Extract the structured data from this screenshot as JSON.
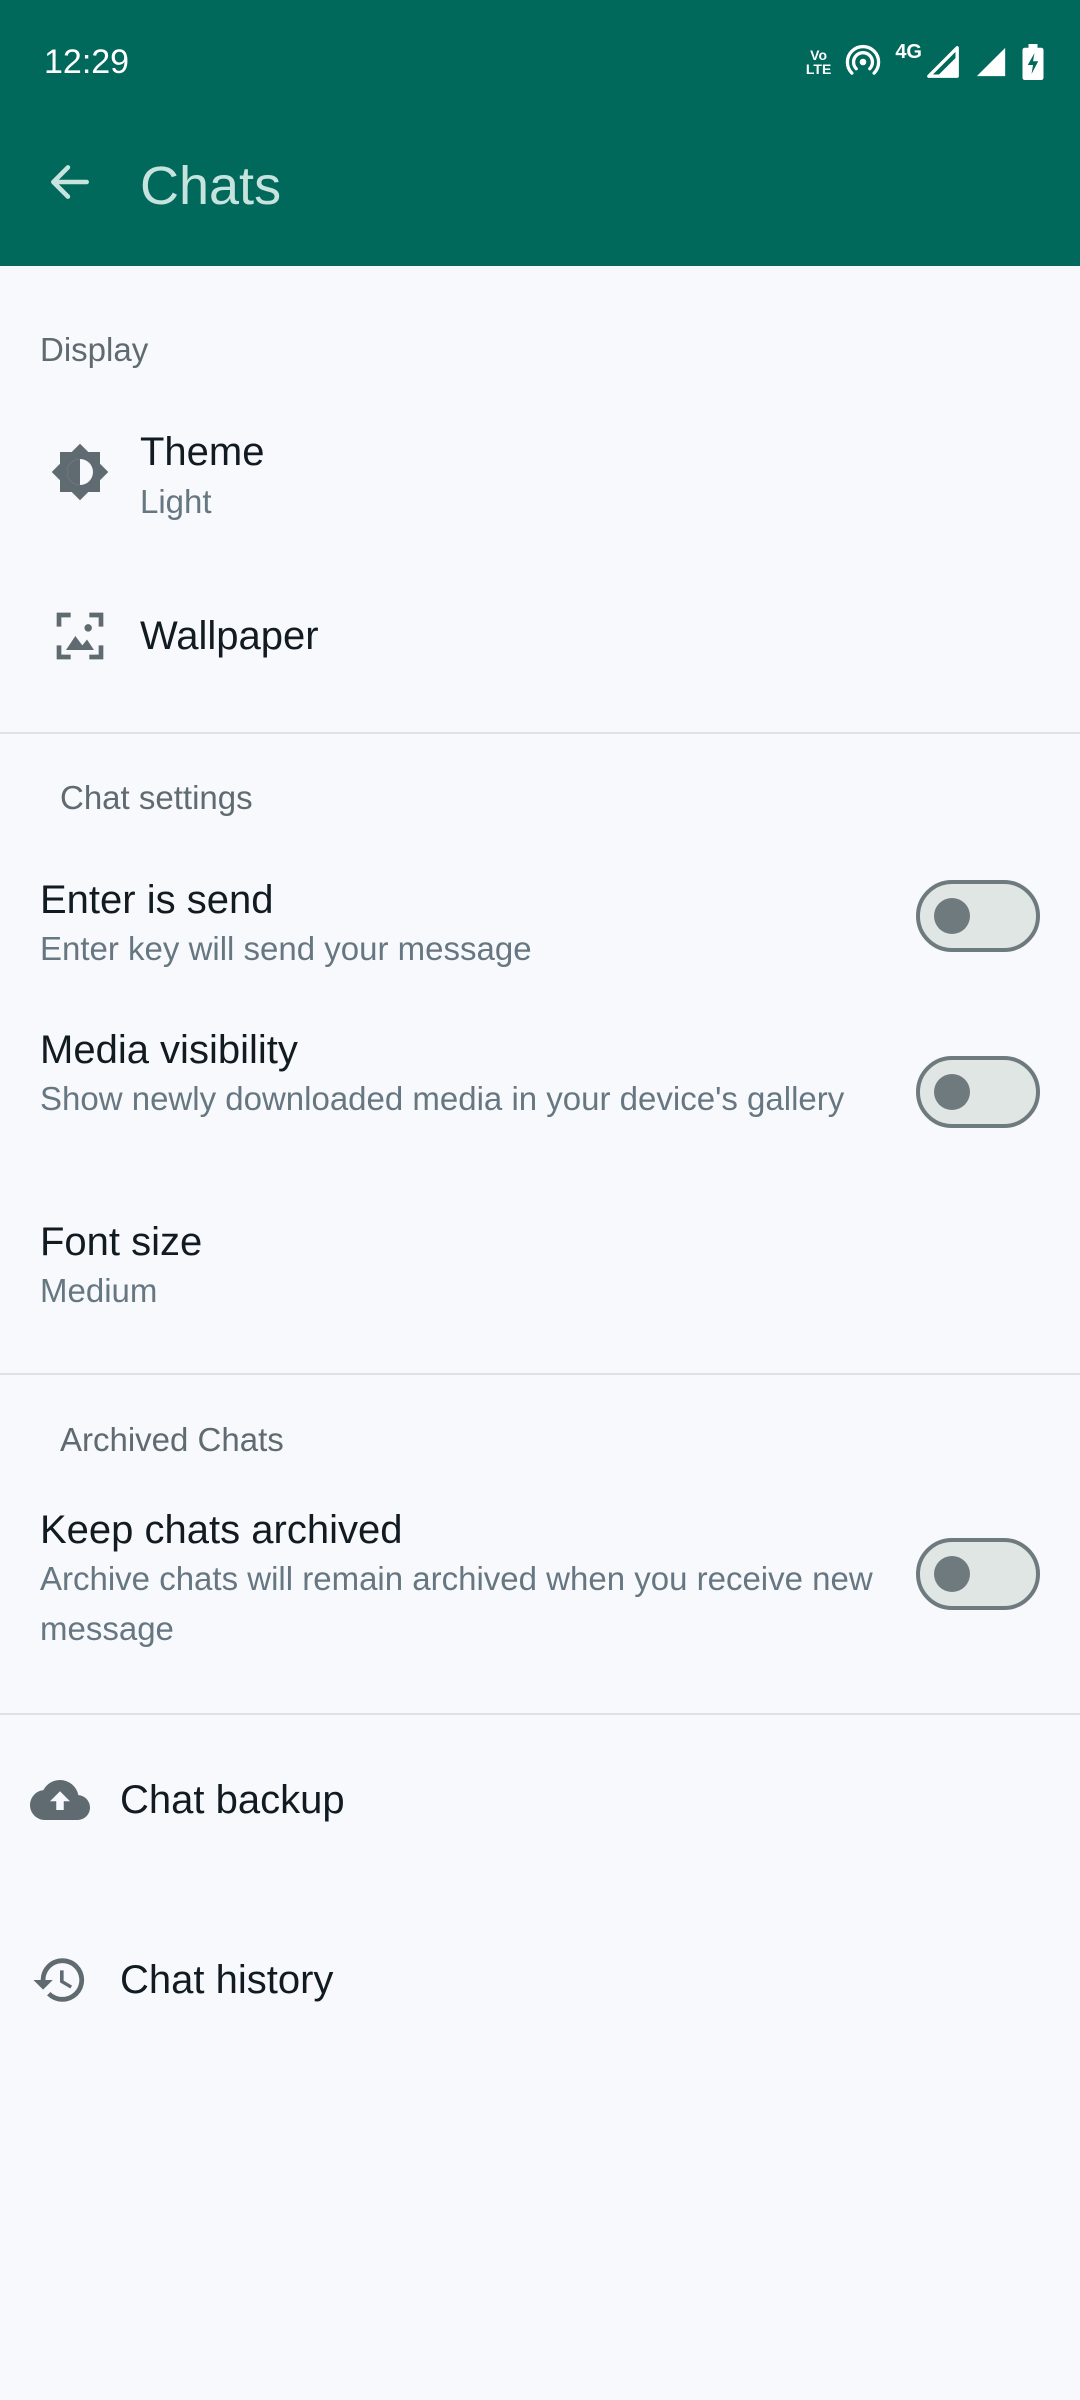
{
  "status_bar": {
    "time": "12:29",
    "volte_top": "Vo",
    "volte_bottom": "LTE",
    "network_label": "4G",
    "icons": [
      "volte-icon",
      "hotspot-icon",
      "signal-icon",
      "signal-icon",
      "battery-charging-icon"
    ]
  },
  "app_bar": {
    "back_icon": "arrow-back-icon",
    "title": "Chats",
    "background": "#00695c"
  },
  "display": {
    "header": "Display",
    "theme": {
      "title": "Theme",
      "subtitle": "Light",
      "icon": "theme-icon"
    },
    "wallpaper": {
      "title": "Wallpaper",
      "icon": "wallpaper-icon"
    }
  },
  "chat_settings": {
    "header": "Chat settings",
    "enter_is_send": {
      "title": "Enter is send",
      "subtitle": "Enter key will send your message",
      "enabled": false
    },
    "media_visibility": {
      "title": "Media visibility",
      "subtitle": "Show newly downloaded media in your device's gallery",
      "enabled": false
    },
    "font_size": {
      "title": "Font size",
      "subtitle": "Medium"
    }
  },
  "archived_chats": {
    "header": "Archived Chats",
    "keep_archived": {
      "title": "Keep chats archived",
      "subtitle": "Archive chats will remain archived when you receive new message",
      "enabled": false
    }
  },
  "backup": {
    "title": "Chat backup",
    "icon": "cloud-upload-icon"
  },
  "history": {
    "title": "Chat history",
    "icon": "history-icon"
  }
}
